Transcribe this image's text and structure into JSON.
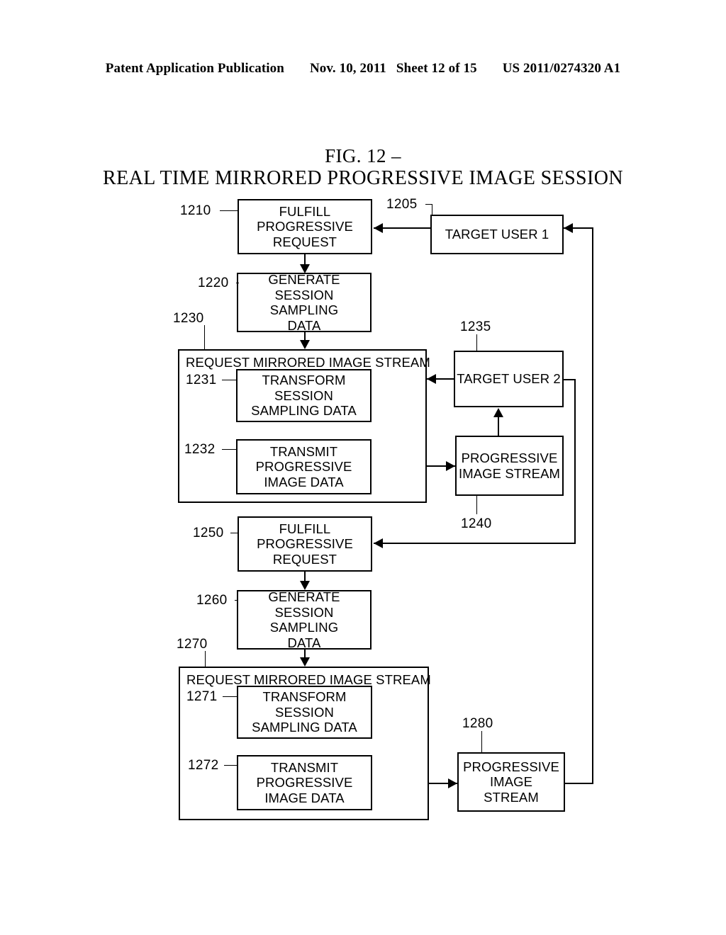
{
  "header": {
    "publication": "Patent Application Publication",
    "date": "Nov. 10, 2011",
    "sheet": "Sheet 12 of 15",
    "number": "US 2011/0274320 A1"
  },
  "figure": {
    "label": "FIG. 12  –",
    "title": "REAL TIME MIRRORED PROGRESSIVE IMAGE SESSION"
  },
  "refs": {
    "r1205": "1205",
    "r1210": "1210",
    "r1220": "1220",
    "r1230": "1230",
    "r1231": "1231",
    "r1232": "1232",
    "r1235": "1235",
    "r1240": "1240",
    "r1250": "1250",
    "r1260": "1260",
    "r1270": "1270",
    "r1271": "1271",
    "r1272": "1272",
    "r1280": "1280"
  },
  "nodes": {
    "fulfill_1": {
      "l1": "FULFILL",
      "l2": "PROGRESSIVE",
      "l3": "REQUEST"
    },
    "target_user_1": {
      "l1": "TARGET USER 1"
    },
    "generate_1": {
      "l1": "GENERATE",
      "l2": "SESSION",
      "l3": "SAMPLING",
      "l4": "DATA"
    },
    "request_stream_1": {
      "title": "REQUEST MIRRORED IMAGE STREAM"
    },
    "transform_1": {
      "l1": "TRANSFORM",
      "l2": "SESSION",
      "l3": "SAMPLING DATA"
    },
    "transmit_1": {
      "l1": "TRANSMIT",
      "l2": "PROGRESSIVE",
      "l3": "IMAGE DATA"
    },
    "target_user_2": {
      "l1": "TARGET USER 2"
    },
    "stream_1": {
      "l1": "PROGRESSIVE",
      "l2": "IMAGE STREAM"
    },
    "fulfill_2": {
      "l1": "FULFILL",
      "l2": "PROGRESSIVE",
      "l3": "REQUEST"
    },
    "generate_2": {
      "l1": "GENERATE",
      "l2": "SESSION",
      "l3": "SAMPLING",
      "l4": "DATA"
    },
    "request_stream_2": {
      "title": "REQUEST MIRRORED IMAGE STREAM"
    },
    "transform_2": {
      "l1": "TRANSFORM",
      "l2": "SESSION",
      "l3": "SAMPLING DATA"
    },
    "transmit_2": {
      "l1": "TRANSMIT",
      "l2": "PROGRESSIVE",
      "l3": "IMAGE DATA"
    },
    "stream_2": {
      "l1": "PROGRESSIVE",
      "l2": "IMAGE",
      "l3": "STREAM"
    }
  },
  "colors": {
    "ink": "#000000",
    "paper": "#ffffff"
  }
}
